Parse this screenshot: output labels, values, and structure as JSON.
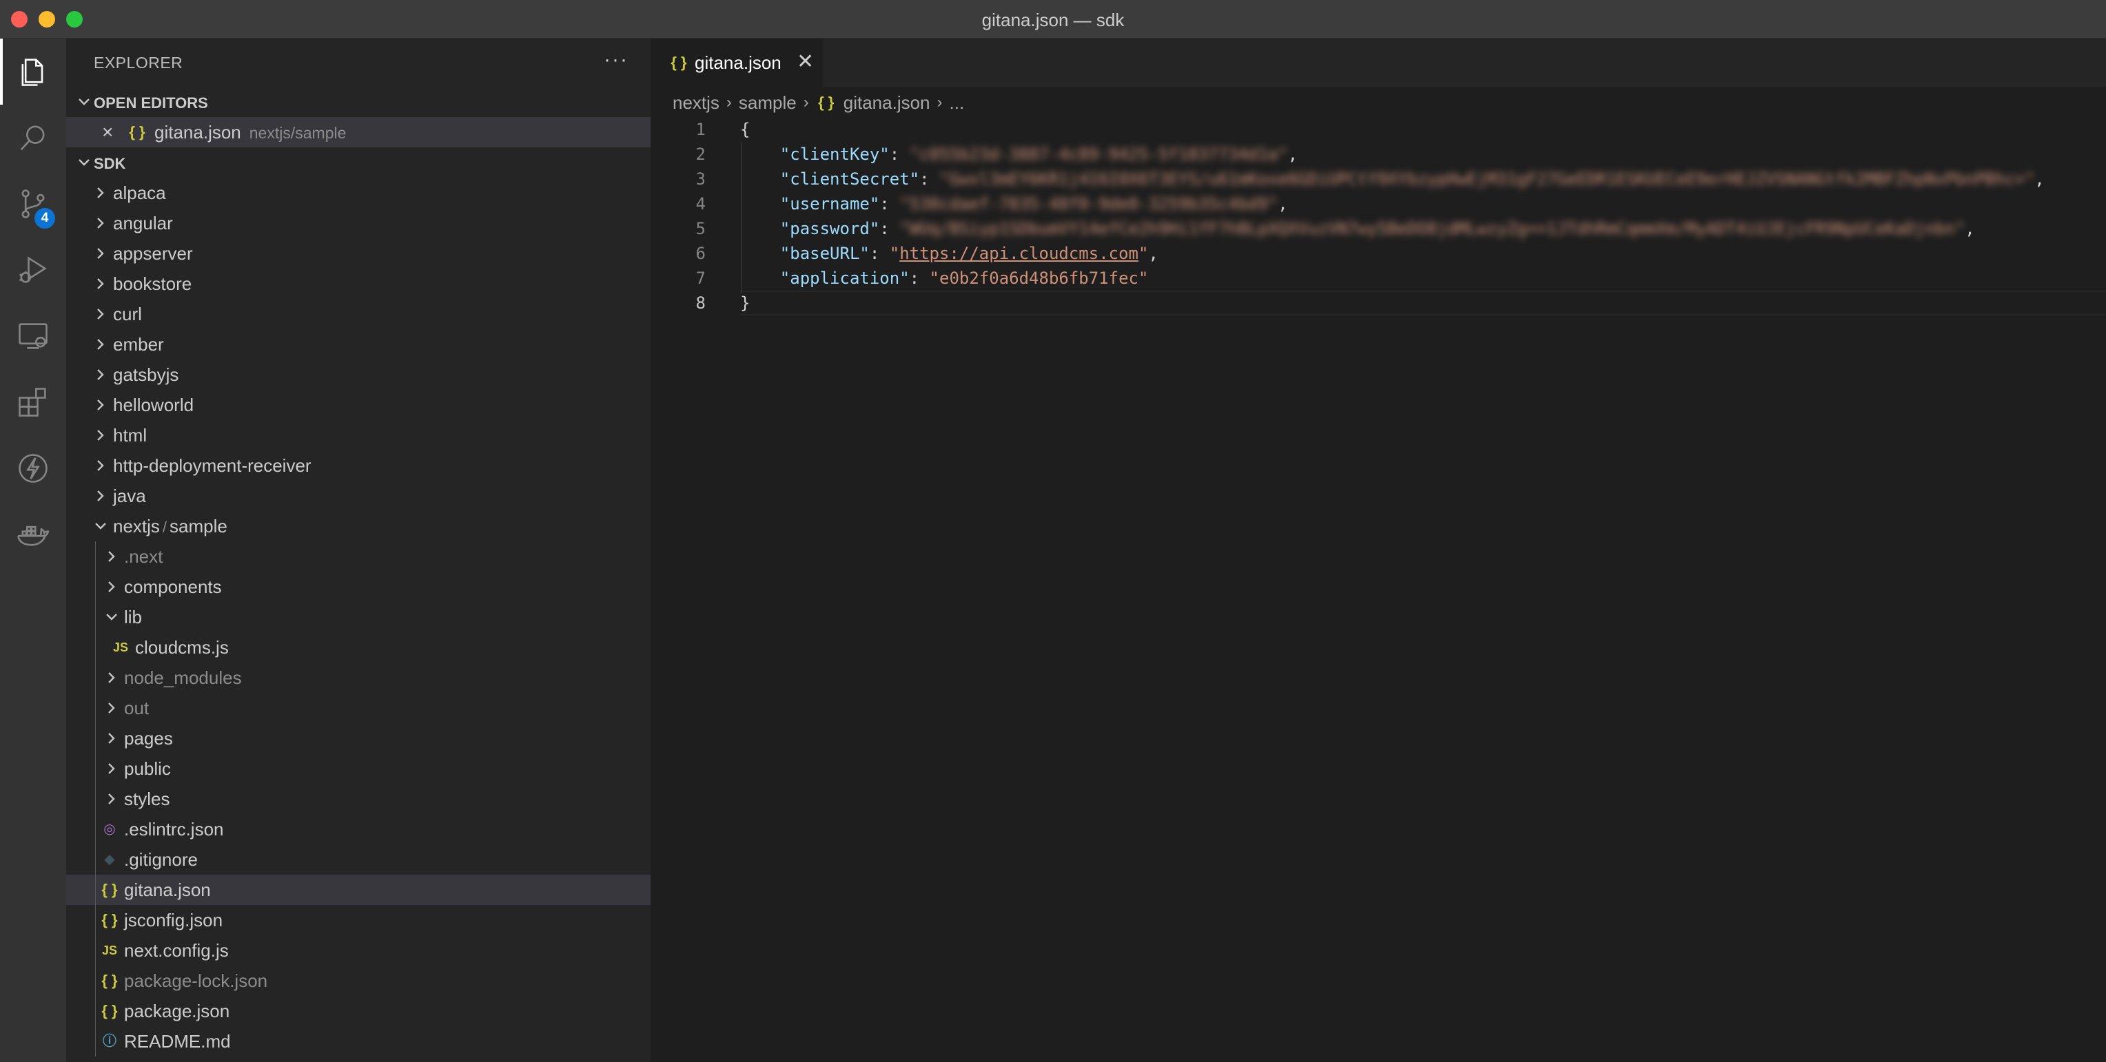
{
  "window": {
    "title": "gitana.json — sdk"
  },
  "activity_bar": {
    "items": [
      {
        "name": "explorer-icon",
        "active": true
      },
      {
        "name": "search-icon"
      },
      {
        "name": "source-control-icon",
        "badge": "4"
      },
      {
        "name": "run-debug-icon"
      },
      {
        "name": "remote-explorer-icon"
      },
      {
        "name": "extensions-icon"
      },
      {
        "name": "lightning-icon"
      },
      {
        "name": "docker-icon"
      }
    ]
  },
  "sidebar": {
    "header": "EXPLORER",
    "more": "···",
    "open_editors": {
      "title": "OPEN EDITORS",
      "items": [
        {
          "name": "gitana.json",
          "desc": "nextjs/sample"
        }
      ]
    },
    "workspace": {
      "title": "SDK",
      "folders": [
        "alpaca",
        "angular",
        "appserver",
        "bookstore",
        "curl",
        "ember",
        "gatsbyjs",
        "helloworld",
        "html",
        "http-deployment-receiver",
        "java"
      ],
      "expanded_folder": {
        "name": "nextjs",
        "sep": "/",
        "sub": "sample"
      },
      "children": [
        {
          "name": ".next",
          "type": "folder",
          "dim": true
        },
        {
          "name": "components",
          "type": "folder"
        },
        {
          "name": "lib",
          "type": "folder",
          "open": true
        },
        {
          "name": "cloudcms.js",
          "type": "js",
          "depth": 2
        },
        {
          "name": "node_modules",
          "type": "folder",
          "dim": true
        },
        {
          "name": "out",
          "type": "folder",
          "dim": true
        },
        {
          "name": "pages",
          "type": "folder"
        },
        {
          "name": "public",
          "type": "folder"
        },
        {
          "name": "styles",
          "type": "folder"
        },
        {
          "name": ".eslintrc.json",
          "type": "eslint"
        },
        {
          "name": ".gitignore",
          "type": "git"
        },
        {
          "name": "gitana.json",
          "type": "json",
          "selected": true
        },
        {
          "name": "jsconfig.json",
          "type": "json"
        },
        {
          "name": "next.config.js",
          "type": "js"
        },
        {
          "name": "package-lock.json",
          "type": "json",
          "dim": true
        },
        {
          "name": "package.json",
          "type": "json"
        },
        {
          "name": "README.md",
          "type": "info"
        }
      ]
    }
  },
  "icons": {
    "json": "{ }",
    "js": "JS",
    "eslint": "◎",
    "git": "◆",
    "info": "ⓘ"
  },
  "editor": {
    "tab": {
      "label": "gitana.json",
      "close": "✕"
    },
    "breadcrumb": [
      "nextjs",
      "sample",
      "gitana.json",
      "..."
    ],
    "lines": [
      {
        "n": "1",
        "open": "{"
      },
      {
        "n": "2",
        "key": "\"clientKey\"",
        "value": "\"c055b23d-3887-4c89-9425-5f1837734d1a\"",
        "blurred": true
      },
      {
        "n": "3",
        "key": "\"clientSecret\"",
        "value": "\"Gwxl3mEY6KR1j4I6I0X6T3EYS/u61mKoxe6GDiUPCtY9XYbzypHwEjM31gF27GeEDR1ESKUECeE9erHEJZVSNANGtfk2MBFZhpNxPbnPBhc=\"",
        "blurred": true
      },
      {
        "n": "4",
        "key": "\"username\"",
        "value": "\"530cdaef-7835-48f0-9de0-3259b35c4bd9\"",
        "blurred": true
      },
      {
        "n": "5",
        "key": "\"password\"",
        "value": "\"WUq/BSiyp1SDbumVY14efCe2h9Hi1fF7hBLpXQXVuzVN7wy5BeDO8jdMLwzyZg==1JTdhRmCqmmXm/MyADT4iUJEjcFR9NpUCeKaDjnbn\"",
        "blurred": true
      },
      {
        "n": "6",
        "key": "\"baseURL\"",
        "value": "https://api.cloudcms.com",
        "url": true
      },
      {
        "n": "7",
        "key": "\"application\"",
        "value": "\"e0b2f0a6d48b6fb71fec\""
      },
      {
        "n": "8",
        "close": "}"
      }
    ],
    "current_line": "8"
  }
}
